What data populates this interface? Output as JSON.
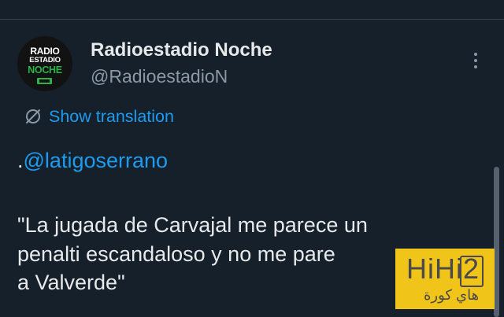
{
  "tweet": {
    "avatar": {
      "logo_lines": [
        "RADIO",
        "ESTADIO",
        "NOCHE"
      ]
    },
    "display_name": "Radioestadio Noche",
    "handle": "@RadioestadioN",
    "more_icon": "more-vertical-icon",
    "translate": {
      "icon": "globe-slash-icon",
      "label": "Show translation"
    },
    "mention_prefix": ".",
    "mention": "@latigoserrano",
    "quote_lines": [
      "\"La jugada de Carvajal me parece un",
      "penalti escandaloso y no me pare",
      "a Valverde\""
    ]
  },
  "watermark": {
    "latin": "HiHi2",
    "arabic": "هاي كورة"
  },
  "colors": {
    "background": "#15202b",
    "text_primary": "#e7e9ea",
    "text_secondary": "#8b98a5",
    "accent": "#1d9bf0",
    "divider": "#38444d",
    "watermark_bg": "#f0c419"
  }
}
